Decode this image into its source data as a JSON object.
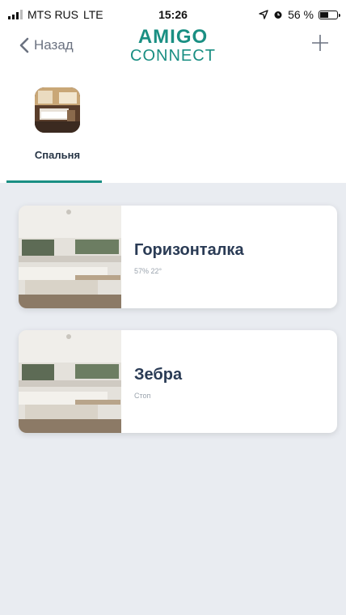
{
  "status_bar": {
    "carrier": "MTS RUS",
    "network": "LTE",
    "time": "15:26",
    "battery": "56 %",
    "battery_level": 0.56
  },
  "nav": {
    "back_label": "Назад",
    "logo_line1": "AMIGO",
    "logo_line2": "CONNECT",
    "add_icon": "plus-icon"
  },
  "rooms": [
    {
      "label": "Спальня",
      "selected": true
    }
  ],
  "devices": [
    {
      "name": "Горизонталка",
      "status": "57% 22°"
    },
    {
      "name": "Зебра",
      "status": "Стоп"
    }
  ],
  "colors": {
    "accent": "#1a8f83",
    "title_text": "#2a3b55",
    "background": "#e9ecf1"
  }
}
